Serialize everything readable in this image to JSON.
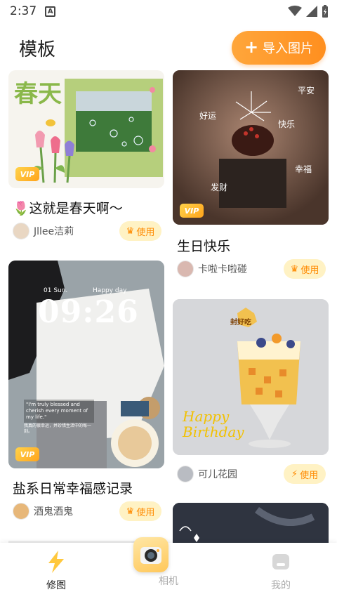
{
  "status": {
    "time": "2:37",
    "notif": "A"
  },
  "header": {
    "title": "模板",
    "import_label": "导入图片"
  },
  "cards": [
    {
      "title": "🌷这就是春天啊～",
      "author": "Jllee洁莉",
      "use_label": "使用",
      "vip": "VIP",
      "image_caption": "春天"
    },
    {
      "title": "生日快乐",
      "author": "卡啦卡啦碰",
      "use_label": "使用",
      "vip": "VIP",
      "image_words": [
        "平安",
        "好运",
        "快乐",
        "幸福",
        "发财"
      ]
    },
    {
      "title": "盐系日常幸福感记录",
      "author": "酒鬼酒鬼",
      "use_label": "使用",
      "vip": "VIP",
      "image_time": "09:26",
      "image_date": "01 Sun.",
      "image_day": "Happy day",
      "image_quote": "\"I'm truly blessed and cherish every moment of my life.\"",
      "image_quote_cn": "我真的很幸运，并珍惜生活中的每一刻。"
    },
    {
      "title": "",
      "author": "可儿花园",
      "use_label": "使用",
      "image_text": "Happy Birthday",
      "image_sticker": "封好吃"
    }
  ],
  "nav": {
    "items": [
      {
        "label": "修图"
      },
      {
        "label": "相机"
      },
      {
        "label": "我的"
      }
    ]
  },
  "colors": {
    "accent": "#ff9a2e",
    "use_bg": "#fff2c4",
    "use_text": "#ff8a00"
  }
}
